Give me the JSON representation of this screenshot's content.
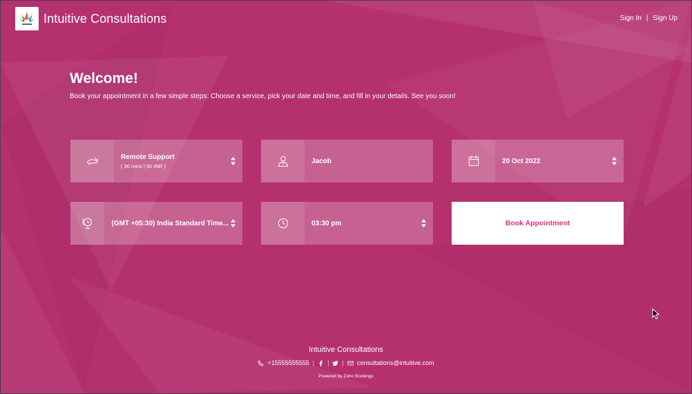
{
  "header": {
    "brand": "Intuitive Consultations",
    "sign_in": "Sign In",
    "separator": "|",
    "sign_up": "Sign Up"
  },
  "main": {
    "title": "Welcome!",
    "intro": "Book your appointment in a few simple steps: Choose a service, pick your date and time, and fill in your details. See you soon!"
  },
  "fields": {
    "service": {
      "value": "Remote Support",
      "sub": "( 30 mins | 50 INR )",
      "icon": "service-icon"
    },
    "staff": {
      "value": "Jacob",
      "icon": "person-icon"
    },
    "date": {
      "value": "20 Oct 2022",
      "icon": "calendar-icon"
    },
    "timezone": {
      "value": "(GMT +05:30) India Standard Time...",
      "icon": "globe-clock-icon"
    },
    "time": {
      "value": "03:30 pm",
      "icon": "clock-icon"
    }
  },
  "actions": {
    "book": "Book Appointment"
  },
  "footer": {
    "name": "Intuitive Consultations",
    "phone": "+15555555555",
    "email": "consultations@intuitive.com",
    "powered": "Powered by Zoho Bookings"
  },
  "colors": {
    "background": "#b5306f",
    "button_text": "#d0367e",
    "field_bg": "rgba(255,255,255,0.24)"
  }
}
